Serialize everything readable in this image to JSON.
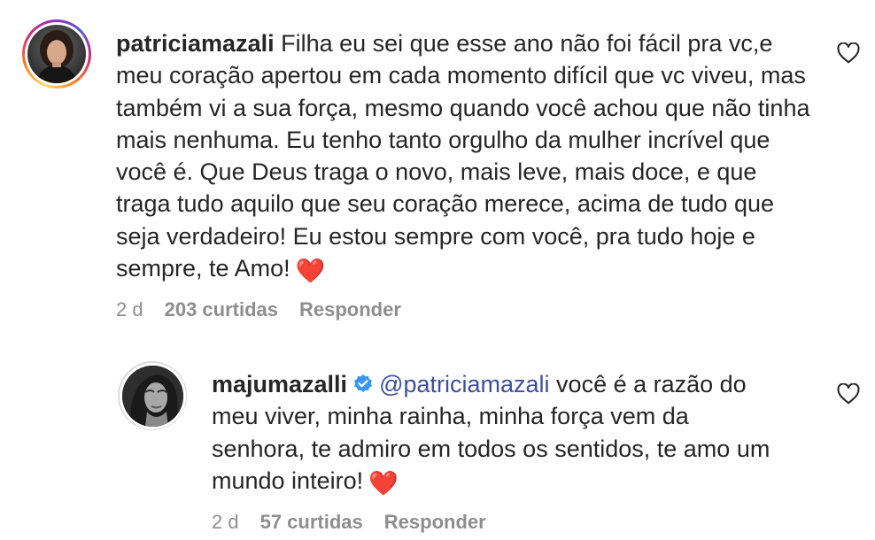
{
  "comments": [
    {
      "username": "patriciamazali",
      "text": "Filha eu sei que esse ano não foi fácil pra vc,e meu coração apertou em cada momento difícil que vc viveu, mas também vi a sua força, mesmo quando você achou que não tinha mais nenhuma. Eu tenho tanto orgulho da mulher incrível que você é. Que Deus traga o novo, mais leve, mais doce, e que traga tudo aquilo que seu coração merece, acima de tudo que seja verdadeiro! Eu estou sempre com você, pra tudo hoje e sempre, te Amo!",
      "emoji": "❤️",
      "time": "2 d",
      "likes": "203 curtidas",
      "reply_label": "Responder",
      "like_icon": "heart-outline-icon",
      "has_story": true
    },
    {
      "username": "majumazalli",
      "verified": true,
      "mention": "@patriciamazali",
      "text": "você é a razão do meu viver, minha rainha, minha força vem da senhora, te admiro em todos os sentidos, te amo um mundo inteiro!",
      "emoji": "❤️",
      "time": "2 d",
      "likes": "57 curtidas",
      "reply_label": "Responder",
      "like_icon": "heart-outline-icon",
      "has_story": false
    }
  ],
  "colors": {
    "text": "#262626",
    "secondary": "#8e8e8e",
    "mention": "#3f4f9b",
    "verified": "#3897f0",
    "heart_emoji": "#e0245e"
  }
}
